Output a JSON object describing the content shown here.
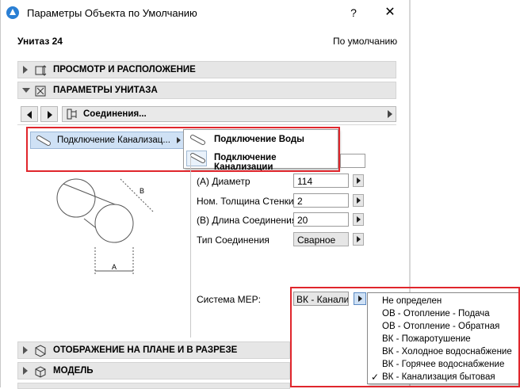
{
  "window": {
    "title": "Параметры Объекта по Умолчанию",
    "help": "?",
    "close": "✕"
  },
  "header": {
    "object_name": "Унитаз 24",
    "default_label": "По умолчанию"
  },
  "sections": {
    "view_placement": "ПРОСМОТР И РАСПОЛОЖЕНИЕ",
    "toilet_params": "ПАРАМЕТРЫ УНИТАЗА",
    "plan_section": "ОТОБРАЖЕНИЕ НА ПЛАНЕ И В РАЗРЕЗЕ",
    "model": "МОДЕЛЬ"
  },
  "nav": {
    "selector_label": "Соединения..."
  },
  "connection": {
    "current": "Подключение Канализац...",
    "menu": [
      "Подключение Воды",
      "Подключение Канализации"
    ]
  },
  "diagram": {
    "label_a": "A",
    "label_b": "B"
  },
  "params": [
    {
      "label": "(A) Диаметр",
      "value": "114"
    },
    {
      "label": "Ном. Толщина Стенки",
      "value": "2"
    },
    {
      "label": "(B) Длина Соединения",
      "value": "20"
    }
  ],
  "conn_type": {
    "label": "Тип Соединения",
    "value": "Сварное"
  },
  "mep": {
    "label": "Система MEP:",
    "value": "ВК - Канали:",
    "options": [
      "Не определен",
      "ОВ - Отопление - Подача",
      "ОВ - Отопление - Обратная",
      "ВК - Пожаротушение",
      "ВК - Холодное водоснабжение",
      "ВК - Горячее водоснабжение",
      "ВК - Канализация бытовая"
    ],
    "checked_mark": "✓"
  }
}
